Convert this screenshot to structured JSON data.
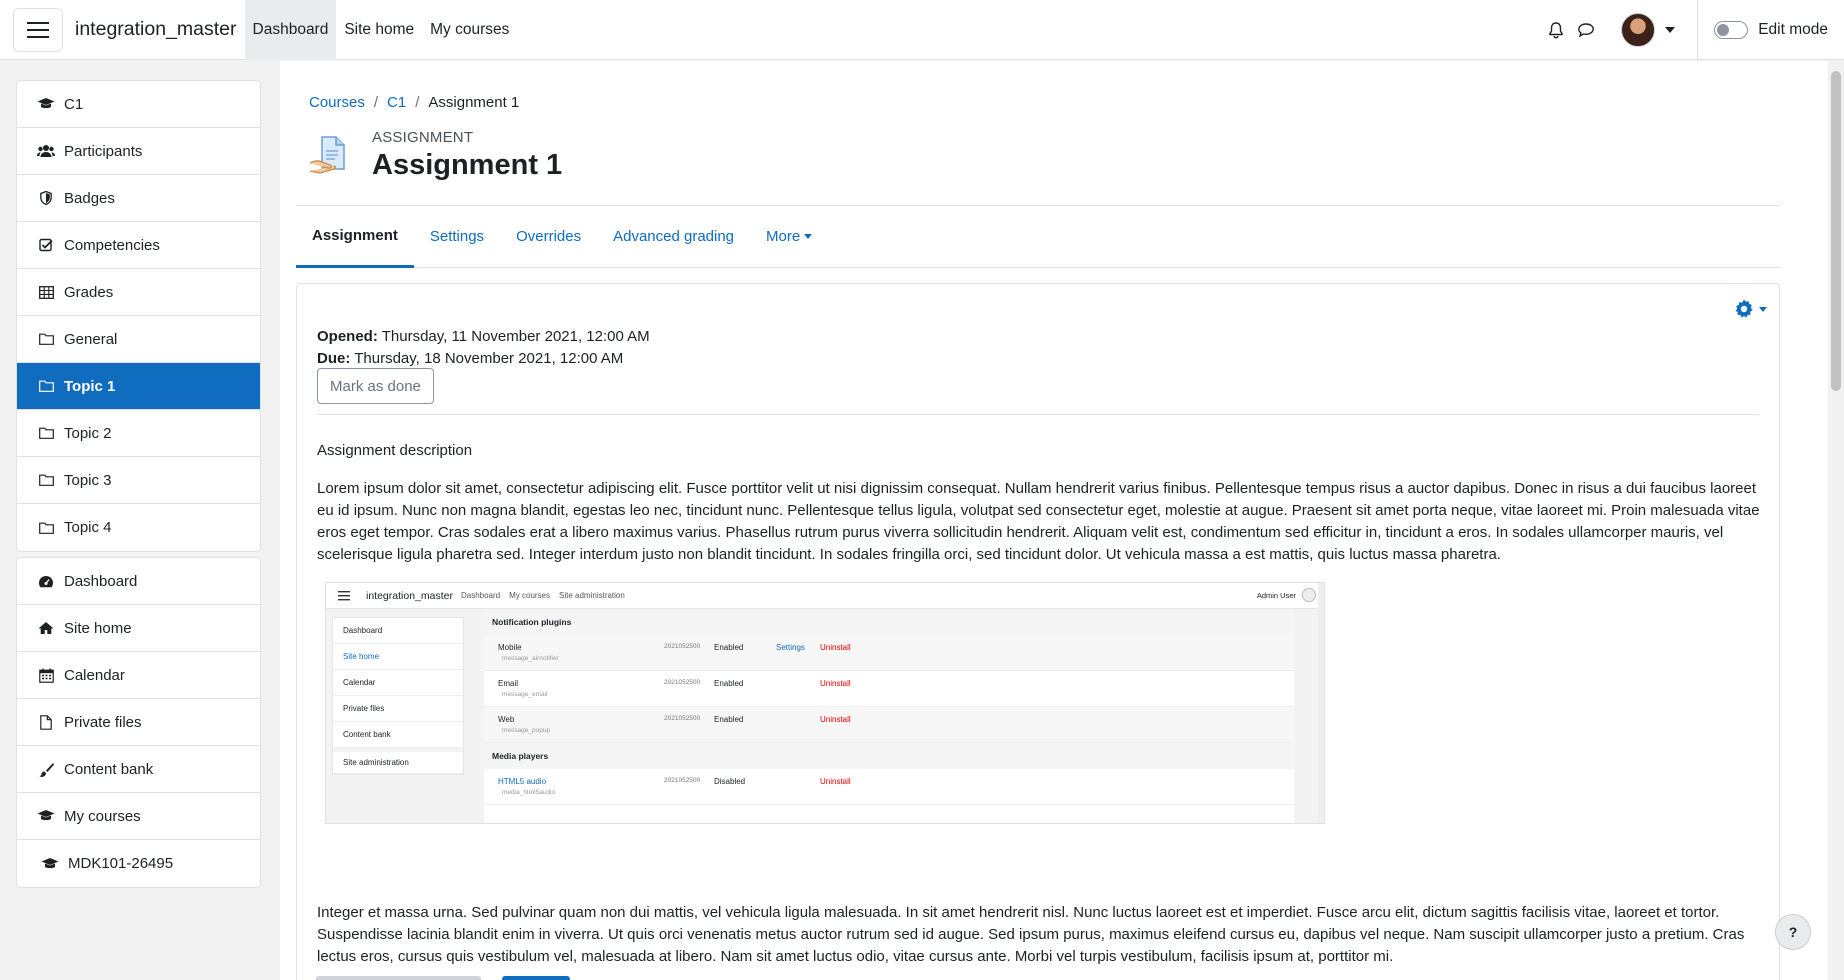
{
  "navbar": {
    "brand": "integration_master",
    "items": [
      {
        "label": "Dashboard",
        "active": true
      },
      {
        "label": "Site home",
        "active": false
      },
      {
        "label": "My courses",
        "active": false
      }
    ],
    "edit_mode_label": "Edit mode",
    "edit_mode_on": false
  },
  "sidebar": {
    "course_items": [
      {
        "label": "C1",
        "icon": "graduation-cap-icon"
      },
      {
        "label": "Participants",
        "icon": "users-icon"
      },
      {
        "label": "Badges",
        "icon": "shield-icon"
      },
      {
        "label": "Competencies",
        "icon": "check-square-icon"
      },
      {
        "label": "Grades",
        "icon": "table-icon"
      },
      {
        "label": "General",
        "icon": "folder-icon"
      },
      {
        "label": "Topic 1",
        "icon": "folder-icon",
        "active": true
      },
      {
        "label": "Topic 2",
        "icon": "folder-icon"
      },
      {
        "label": "Topic 3",
        "icon": "folder-icon"
      },
      {
        "label": "Topic 4",
        "icon": "folder-icon"
      }
    ],
    "site_items": [
      {
        "label": "Dashboard",
        "icon": "tachometer-icon"
      },
      {
        "label": "Site home",
        "icon": "home-icon"
      },
      {
        "label": "Calendar",
        "icon": "calendar-icon"
      },
      {
        "label": "Private files",
        "icon": "file-icon"
      },
      {
        "label": "Content bank",
        "icon": "brush-icon"
      },
      {
        "label": "My courses",
        "icon": "graduation-cap-icon"
      },
      {
        "label": "MDK101-26495",
        "icon": "graduation-cap-icon"
      }
    ]
  },
  "breadcrumb": {
    "items": [
      "Courses",
      "C1"
    ],
    "current": "Assignment 1",
    "separator": "/"
  },
  "header": {
    "pre_title": "ASSIGNMENT",
    "title": "Assignment 1"
  },
  "tabs": [
    {
      "label": "Assignment",
      "active": true
    },
    {
      "label": "Settings"
    },
    {
      "label": "Overrides"
    },
    {
      "label": "Advanced grading"
    },
    {
      "label": "More"
    }
  ],
  "content": {
    "opened_label": "Opened:",
    "opened_value": "Thursday, 11 November 2021, 12:00 AM",
    "due_label": "Due:",
    "due_value": "Thursday, 18 November 2021, 12:00 AM",
    "mark_done_label": "Mark as done",
    "description_title": "Assignment description",
    "paragraph1": "Lorem ipsum dolor sit amet, consectetur adipiscing elit. Fusce porttitor velit ut nisi dignissim consequat. Nullam hendrerit varius finibus. Pellentesque tempus risus a auctor dapibus. Donec in risus a dui faucibus laoreet eu id ipsum. Nunc non magna blandit, egestas leo nec, tincidunt nunc. Pellentesque tellus ligula, volutpat sed consectetur eget, molestie at augue. Praesent sit amet porta neque, vitae laoreet mi. Proin malesuada vitae eros eget tempor. Cras sodales erat a libero maximus varius. Phasellus rutrum purus viverra sollicitudin hendrerit. Aliquam velit est, condimentum sed efficitur in, tincidunt a eros. In sodales ullamcorper mauris, vel scelerisque ligula pharetra sed. Integer interdum justo non blandit tincidunt. In sodales fringilla orci, sed tincidunt dolor. Ut vehicula massa a est mattis, quis luctus massa pharetra.",
    "paragraph2": "Integer et massa urna. Sed pulvinar quam non dui mattis, vel vehicula ligula malesuada. In sit amet hendrerit nisl. Nunc luctus laoreet est et imperdiet. Fusce arcu elit, dictum sagittis facilisis vitae, laoreet et tortor. Suspendisse lacinia blandit enim in viverra. Ut quis orci venenatis metus auctor rutrum sed id augue. Sed ipsum purus, maximus eleifend cursus eu, dapibus vel neque. Nam suscipit ullamcorper justo a pretium. Cras lectus eros, cursus quis vestibulum vel, malesuada at libero. Nam sit amet luctus odio, vitae cursus ante. Morbi vel turpis vestibulum, facilisis ipsum at, porttitor mi."
  },
  "embedded_screenshot": {
    "brand": "integration_master",
    "nav": [
      "Dashboard",
      "My courses",
      "Site administration"
    ],
    "user": "Admin User",
    "side_items": [
      "Dashboard",
      "Site home",
      "Calendar",
      "Private files",
      "Content bank",
      "Site administration"
    ],
    "section1": "Notification plugins",
    "rows1": [
      {
        "name": "Mobile",
        "sub": "message_airnotifier",
        "version": "2021052500",
        "status": "Enabled",
        "settings": "Settings",
        "uninstall": "Uninstall"
      },
      {
        "name": "Email",
        "sub": "message_email",
        "version": "2021052500",
        "status": "Enabled",
        "settings": "",
        "uninstall": "Uninstall"
      },
      {
        "name": "Web",
        "sub": "message_popup",
        "version": "2021052500",
        "status": "Enabled",
        "settings": "",
        "uninstall": "Uninstall"
      }
    ],
    "section2": "Media players",
    "rows2": [
      {
        "name": "HTML5 audio",
        "sub": "media_html5audio",
        "version": "2021052500",
        "status": "Disabled",
        "uninstall": "Uninstall"
      }
    ]
  },
  "help_label": "?",
  "colors": {
    "primary": "#0f6cbf",
    "text": "#1d2125",
    "border": "#dee2e6"
  }
}
